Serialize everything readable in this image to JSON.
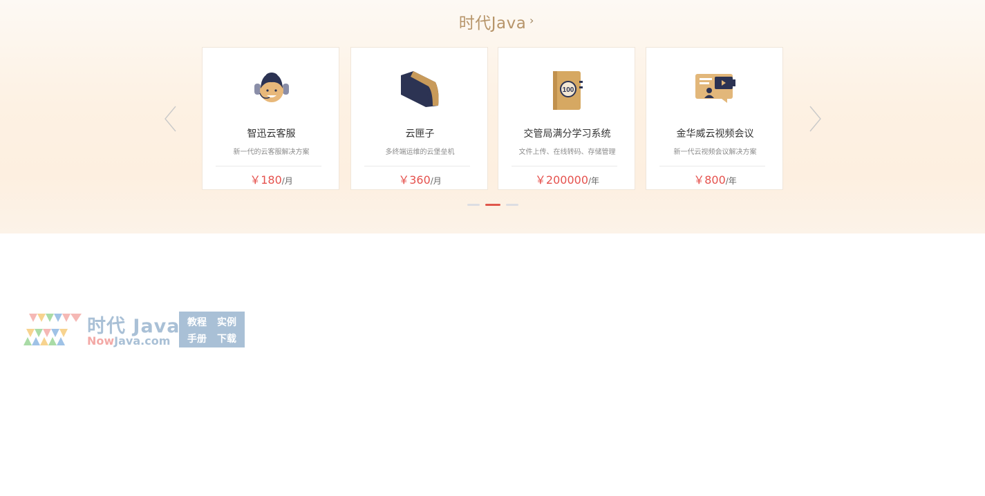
{
  "section": {
    "title": "时代Java",
    "more_glyph": "›"
  },
  "carousel": {
    "prev_icon": "chevron-left-icon",
    "next_icon": "chevron-right-icon",
    "cards": [
      {
        "name": "智迅云客服",
        "desc": "新一代的云客服解决方案",
        "price": "￥180",
        "unit": "/月",
        "icon": "customer-service-agent-icon"
      },
      {
        "name": "云匣子",
        "desc": "多终端运维的云堡垒机",
        "price": "￥360",
        "unit": "/月",
        "icon": "cloud-box-icon"
      },
      {
        "name": "交管局满分学习系统",
        "desc": "文件上传、在线转码、存储管理",
        "price": "￥200000",
        "unit": "/年",
        "icon": "score-book-icon"
      },
      {
        "name": "金华威云视频会议",
        "desc": "新一代云视频会议解决方案",
        "price": "￥800",
        "unit": "/年",
        "icon": "video-conference-icon"
      }
    ],
    "pagination": {
      "pages": 3,
      "active": 2
    }
  },
  "watermark": {
    "brand_cn": "时代 Java",
    "domain_prefix": "Now",
    "domain_rest": "Java.com",
    "tags": [
      "教程",
      "实例",
      "手册",
      "下载"
    ]
  },
  "colors": {
    "price": "#e5514d",
    "title": "#b7956a",
    "dot_active": "#e0574b",
    "watermark": "#a9c0d6"
  }
}
